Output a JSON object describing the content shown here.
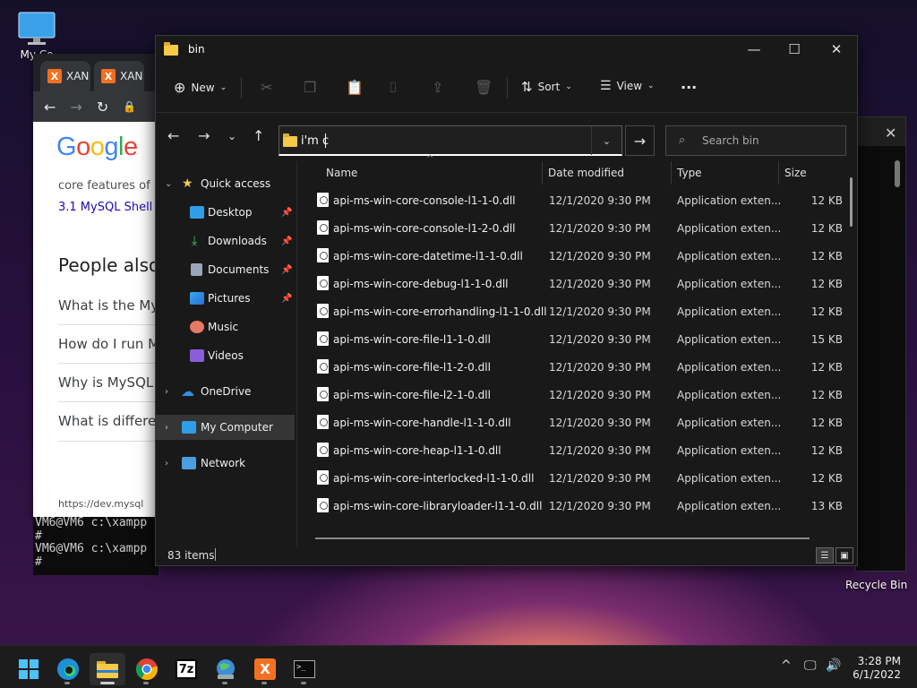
{
  "desktop": {
    "my_computer_label": "My Co",
    "recycle_bin_label": "Recycle Bin"
  },
  "browser": {
    "tabs": [
      {
        "label": "XAN"
      },
      {
        "label": "XAN"
      }
    ],
    "lines": [
      "core features of M",
      "3.1 MySQL Shell"
    ],
    "people_also": "People also",
    "questions": [
      "What is the My",
      "How do I run M",
      "Why is MySQL",
      "What is differe"
    ],
    "footer_url": "https://dev.mysql"
  },
  "console": {
    "lines": [
      "VM6@VM6 c:\\xampp",
      "#",
      "VM6@VM6 c:\\xampp",
      "#"
    ]
  },
  "explorer": {
    "title": "bin",
    "toolbar": {
      "new_label": "New",
      "sort_label": "Sort",
      "view_label": "View",
      "more_label": "···"
    },
    "address_value": "i'm c",
    "search_placeholder": "Search bin",
    "nav": {
      "quick_access": "Quick access",
      "desktop": "Desktop",
      "downloads": "Downloads",
      "documents": "Documents",
      "pictures": "Pictures",
      "music": "Music",
      "videos": "Videos",
      "onedrive": "OneDrive",
      "my_computer": "My Computer",
      "network": "Network"
    },
    "columns": {
      "name": "Name",
      "date": "Date modified",
      "type": "Type",
      "size": "Size"
    },
    "files": [
      {
        "name": "api-ms-win-core-console-l1-1-0.dll",
        "date": "12/1/2020 9:30 PM",
        "type": "Application exten...",
        "size": "12 KB"
      },
      {
        "name": "api-ms-win-core-console-l1-2-0.dll",
        "date": "12/1/2020 9:30 PM",
        "type": "Application exten...",
        "size": "12 KB"
      },
      {
        "name": "api-ms-win-core-datetime-l1-1-0.dll",
        "date": "12/1/2020 9:30 PM",
        "type": "Application exten...",
        "size": "12 KB"
      },
      {
        "name": "api-ms-win-core-debug-l1-1-0.dll",
        "date": "12/1/2020 9:30 PM",
        "type": "Application exten...",
        "size": "12 KB"
      },
      {
        "name": "api-ms-win-core-errorhandling-l1-1-0.dll",
        "date": "12/1/2020 9:30 PM",
        "type": "Application exten...",
        "size": "12 KB"
      },
      {
        "name": "api-ms-win-core-file-l1-1-0.dll",
        "date": "12/1/2020 9:30 PM",
        "type": "Application exten...",
        "size": "15 KB"
      },
      {
        "name": "api-ms-win-core-file-l1-2-0.dll",
        "date": "12/1/2020 9:30 PM",
        "type": "Application exten...",
        "size": "12 KB"
      },
      {
        "name": "api-ms-win-core-file-l2-1-0.dll",
        "date": "12/1/2020 9:30 PM",
        "type": "Application exten...",
        "size": "12 KB"
      },
      {
        "name": "api-ms-win-core-handle-l1-1-0.dll",
        "date": "12/1/2020 9:30 PM",
        "type": "Application exten...",
        "size": "12 KB"
      },
      {
        "name": "api-ms-win-core-heap-l1-1-0.dll",
        "date": "12/1/2020 9:30 PM",
        "type": "Application exten...",
        "size": "12 KB"
      },
      {
        "name": "api-ms-win-core-interlocked-l1-1-0.dll",
        "date": "12/1/2020 9:30 PM",
        "type": "Application exten...",
        "size": "12 KB"
      },
      {
        "name": "api-ms-win-core-libraryloader-l1-1-0.dll",
        "date": "12/1/2020 9:30 PM",
        "type": "Application exten...",
        "size": "13 KB"
      }
    ],
    "status": {
      "item_count": "83 items"
    }
  },
  "taskbar": {
    "apps": [
      "start-icon",
      "edge-icon",
      "file-explorer-icon",
      "chrome-icon",
      "7zip-icon",
      "network-globe-icon",
      "xampp-icon",
      "terminal-icon"
    ],
    "seven_zip_label": "7z",
    "xampp_label": "X",
    "terminal_label": ">_",
    "time": "3:28 PM",
    "date": "6/1/2022"
  },
  "colors": {
    "accent": "#0078d4",
    "folder": "#f7c948",
    "xampp": "#f37021"
  }
}
